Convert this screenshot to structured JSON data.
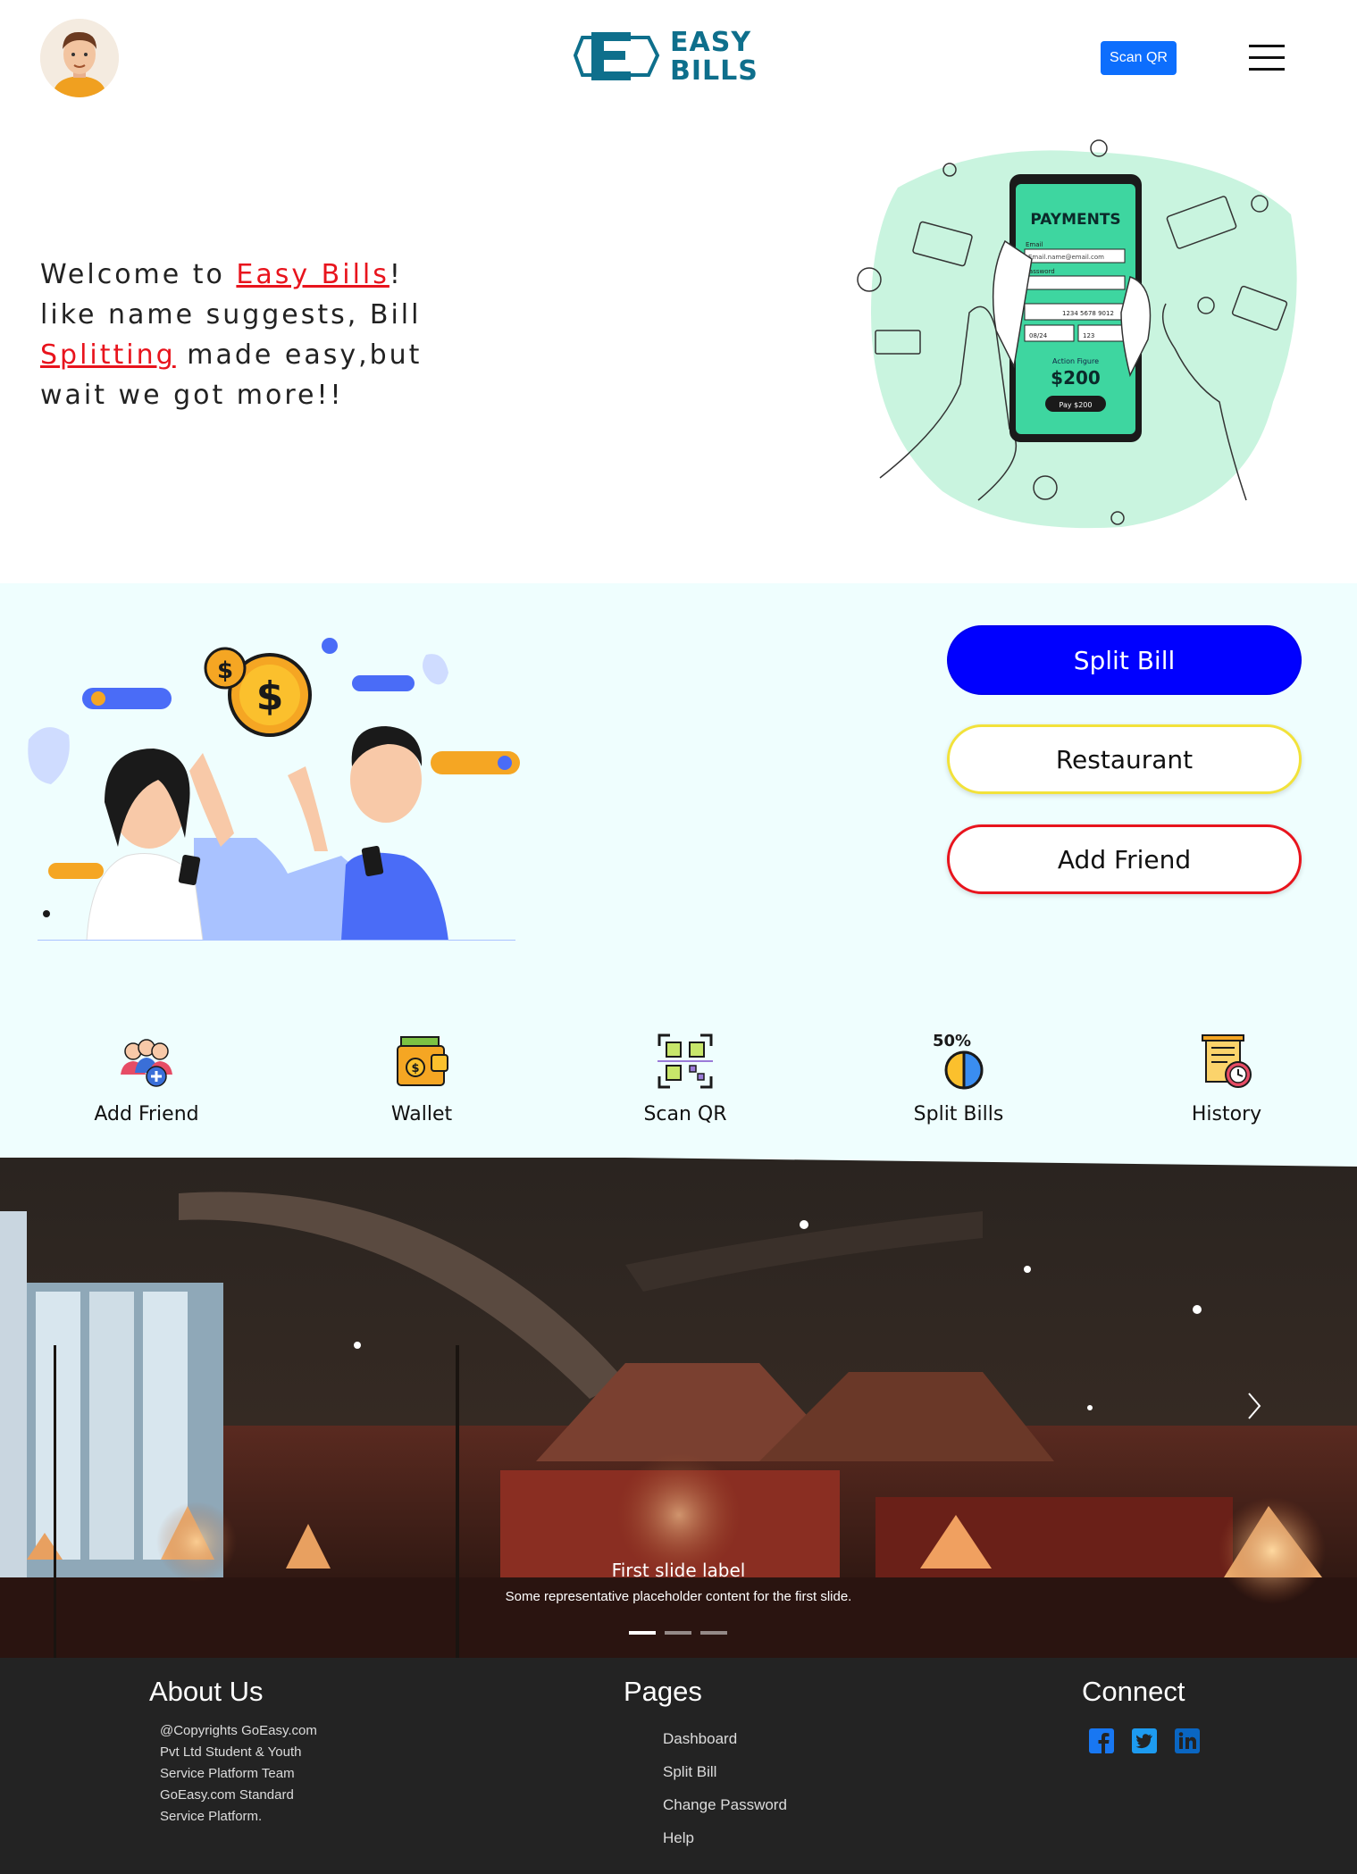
{
  "header": {
    "logo_text_line1": "EASY",
    "logo_text_line2": "BILLS",
    "scan_qr_label": "Scan QR"
  },
  "hero": {
    "text_before_1": "Welcome to ",
    "highlight_1": "Easy Bills",
    "text_after_1": "! like name suggests, Bill ",
    "highlight_2": "Splitting",
    "text_after_2": " made easy,but wait we got more!!",
    "illustration_title": "PAYMENTS",
    "illustration_email_label": "Email",
    "illustration_email_value": "Email.name@email.com",
    "illustration_password_label": "Password",
    "illustration_card_number": "1234 5678 9012",
    "illustration_expiry": "08/24",
    "illustration_cvv": "123",
    "illustration_amount_label": "Action Figure",
    "illustration_amount": "$200",
    "illustration_pay_label": "Pay $200"
  },
  "actions": {
    "split_bill": "Split Bill",
    "restaurant": "Restaurant",
    "add_friend": "Add Friend"
  },
  "features": [
    {
      "label": "Add Friend",
      "icon": "add-friend-icon"
    },
    {
      "label": "Wallet",
      "icon": "wallet-icon"
    },
    {
      "label": "Scan QR",
      "icon": "qr-code-icon"
    },
    {
      "label": "Split Bills",
      "icon": "split-bills-icon"
    },
    {
      "label": "History",
      "icon": "history-icon"
    }
  ],
  "split_icon_text": "50%",
  "carousel": {
    "title": "First slide label",
    "text": "Some representative placeholder content for the first slide.",
    "slide_count": 3,
    "active_slide": 1
  },
  "footer": {
    "about_heading": "About Us",
    "about_lines": [
      "@Copyrights GoEasy.com",
      "Pvt Ltd Student & Youth",
      "Service Platform Team",
      "GoEasy.com Standard",
      "Service Platform."
    ],
    "pages_heading": "Pages",
    "pages": [
      "Dashboard",
      "Split Bill",
      "Change Password",
      "Help"
    ],
    "connect_heading": "Connect",
    "social": [
      "facebook-icon",
      "twitter-icon",
      "linkedin-icon"
    ]
  },
  "colors": {
    "accent": "#0d6efd",
    "highlight": "#e8141d",
    "split_button": "#0000ff",
    "restaurant_border": "#f2e23a",
    "section_bg": "#effefe",
    "footer_bg": "#232323",
    "logo": "#0e6f8c"
  }
}
